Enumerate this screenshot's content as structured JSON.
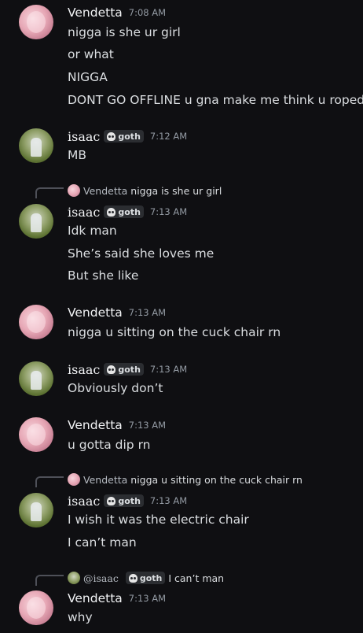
{
  "messages": [
    {
      "author": "Vendetta",
      "time": "7:08 AM",
      "lines": [
        "nigga is she ur girl",
        "or what",
        "NIGGA",
        "DONT GO OFFLINE u gna make me think u roped"
      ]
    },
    {
      "author": "isaac",
      "tag": "goth",
      "time": "7:12 AM",
      "lines": [
        "MB"
      ]
    },
    {
      "reply": {
        "author": "Vendetta",
        "text": "nigga is she ur girl"
      },
      "author": "isaac",
      "tag": "goth",
      "time": "7:13 AM",
      "lines": [
        "Idk man",
        "She’s said she loves me",
        "But she like"
      ]
    },
    {
      "author": "Vendetta",
      "time": "7:13 AM",
      "lines": [
        "nigga u sitting on the cuck chair rn"
      ]
    },
    {
      "author": "isaac",
      "tag": "goth",
      "time": "7:13 AM",
      "lines": [
        "Obviously don’t"
      ]
    },
    {
      "author": "Vendetta",
      "time": "7:13 AM",
      "lines": [
        "u gotta dip rn"
      ]
    },
    {
      "reply": {
        "author": "Vendetta",
        "text": "nigga u sitting on the cuck chair rn"
      },
      "author": "isaac",
      "tag": "goth",
      "time": "7:13 AM",
      "lines": [
        "I wish it was the electric chair",
        "I can’t man"
      ]
    },
    {
      "reply": {
        "author": "@isaac",
        "tag": "goth",
        "text": "I can’t man"
      },
      "author": "Vendetta",
      "time": "7:13 AM",
      "lines": [
        "why"
      ]
    }
  ]
}
